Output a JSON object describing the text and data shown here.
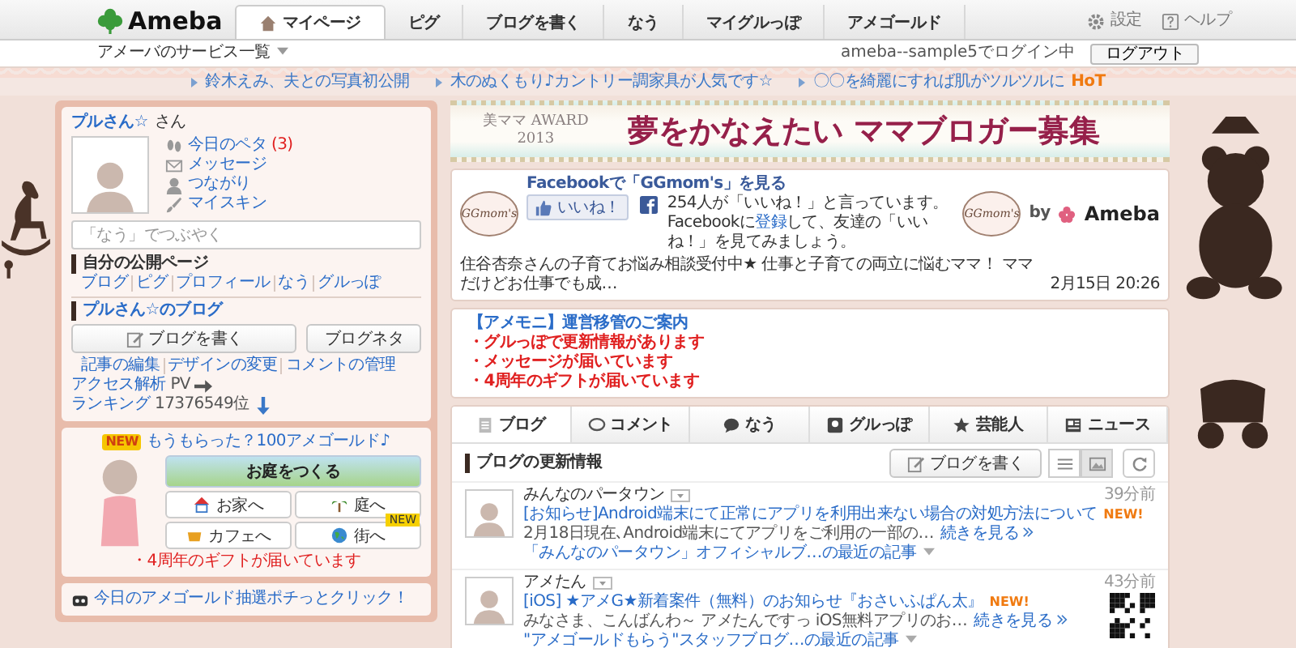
{
  "header": {
    "logo": "Ameba",
    "tabs": [
      {
        "label": "マイページ",
        "selected": true
      },
      {
        "label": "ピグ",
        "selected": false
      },
      {
        "label": "ブログを書く",
        "selected": false
      },
      {
        "label": "なう",
        "selected": false
      },
      {
        "label": "マイグルっぽ",
        "selected": false
      },
      {
        "label": "アメゴールド",
        "selected": false
      }
    ],
    "settings": "設定",
    "help": "ヘルプ"
  },
  "subbar": {
    "services": "アメーバのサービス一覧",
    "login_status": "ameba--sample5でログイン中",
    "logout": "ログアウト"
  },
  "ticker": [
    {
      "text": "鈴木えみ、夫との写真初公開"
    },
    {
      "text": "木のぬくもり♪カントリー調家具が人気です☆"
    },
    {
      "text": "〇〇を綺麗にすれば肌がツルツルに",
      "hot": "HoT"
    }
  ],
  "profile": {
    "name": "プルさん☆",
    "honorific": "さん",
    "links": [
      {
        "label": "今日のペタ",
        "count": "(3)"
      },
      {
        "label": "メッセージ"
      },
      {
        "label": "つながり"
      },
      {
        "label": "マイスキン"
      }
    ],
    "now_placeholder": "「なう」でつぶやく",
    "public_title": "自分の公開ページ",
    "public_links": [
      "ブログ",
      "ピグ",
      "プロフィール",
      "なう",
      "グルっぽ"
    ],
    "blog_title": "プルさん☆のブログ",
    "write_button": "ブログを書く",
    "neta_button": "ブログネタ",
    "blog_links": [
      "記事の編集",
      "デザインの変更",
      "コメントの管理"
    ],
    "access_label": "アクセス解析",
    "pv": "PV",
    "ranking_label": "ランキング",
    "ranking": "17376549位"
  },
  "gold": {
    "new_badge": "NEW",
    "headline": "もうもらった？100アメゴールド♪",
    "garden": "お庭をつくる",
    "buttons": [
      {
        "label": "お家へ"
      },
      {
        "label": "庭へ"
      },
      {
        "label": "カフェへ"
      },
      {
        "label": "街へ",
        "badge": "NEW"
      }
    ],
    "notice": "・4周年のギフトが届いています"
  },
  "lottery": {
    "text": "今日のアメゴールド抽選ポチっとクリック！"
  },
  "banner": {
    "award": "美ママ AWARD",
    "year": "2013",
    "headline": "夢をかなえたい ママブロガー募集"
  },
  "facebook": {
    "title": "Facebookで「GGmom's」を見る",
    "like": "いいね！",
    "text_before": "254人が「いいね！」と言っています。Facebookに",
    "text_link": "登録",
    "text_after": "して、友達の「いいね！」を見てみましょう。",
    "brand_logos": [
      "GGmom's",
      "GGmom's"
    ],
    "by": "by",
    "ameba": "Ameba",
    "news": "住谷杏奈さんの子育てお悩み相談受付中★ 仕事と子育ての両立に悩むママ！ ママだけどお仕事でも成…",
    "date": "2月15日 20:26"
  },
  "notices": {
    "title": "【アメモニ】運営移管のご案内",
    "items": [
      "・グルっぽで更新情報があります",
      "・メッセージが届いています",
      "・4周年のギフトが届いています"
    ]
  },
  "feed": {
    "tabs": [
      {
        "label": "ブログ",
        "selected": true
      },
      {
        "label": "コメント",
        "selected": false
      },
      {
        "label": "なう",
        "selected": false
      },
      {
        "label": "グルっぽ",
        "selected": false
      },
      {
        "label": "芸能人",
        "selected": false
      },
      {
        "label": "ニュース",
        "selected": false
      }
    ],
    "section_title": "ブログの更新情報",
    "write_button": "ブログを書く",
    "views": [
      {
        "selected": false
      },
      {
        "selected": true
      }
    ],
    "items": [
      {
        "author": "みんなのパータウン",
        "time": "39分前",
        "title": "[お知らせ]Android端末にて正常にアプリを利用出来ない場合の対処方法について",
        "new": "NEW!",
        "excerpt": "2月18日現在､Android端末にてアプリをご利用の一部の…",
        "more": "続きを見る",
        "recent": "「みんなのパータウン」オフィシャルブ…の最近の記事",
        "qr": false
      },
      {
        "author": "アメたん",
        "time": "43分前",
        "title": "[iOS] ★アメG★新着案件（無料）のお知らせ『おさいふぱん太』",
        "new": "NEW!",
        "excerpt": "みなさま、こんばんわ～ アメたんですっ iOS無料アプリのお…",
        "more": "続きを見る",
        "recent": "\"アメゴールドもらう\"スタッフブログ…の最近の記事",
        "qr": true
      }
    ]
  }
}
